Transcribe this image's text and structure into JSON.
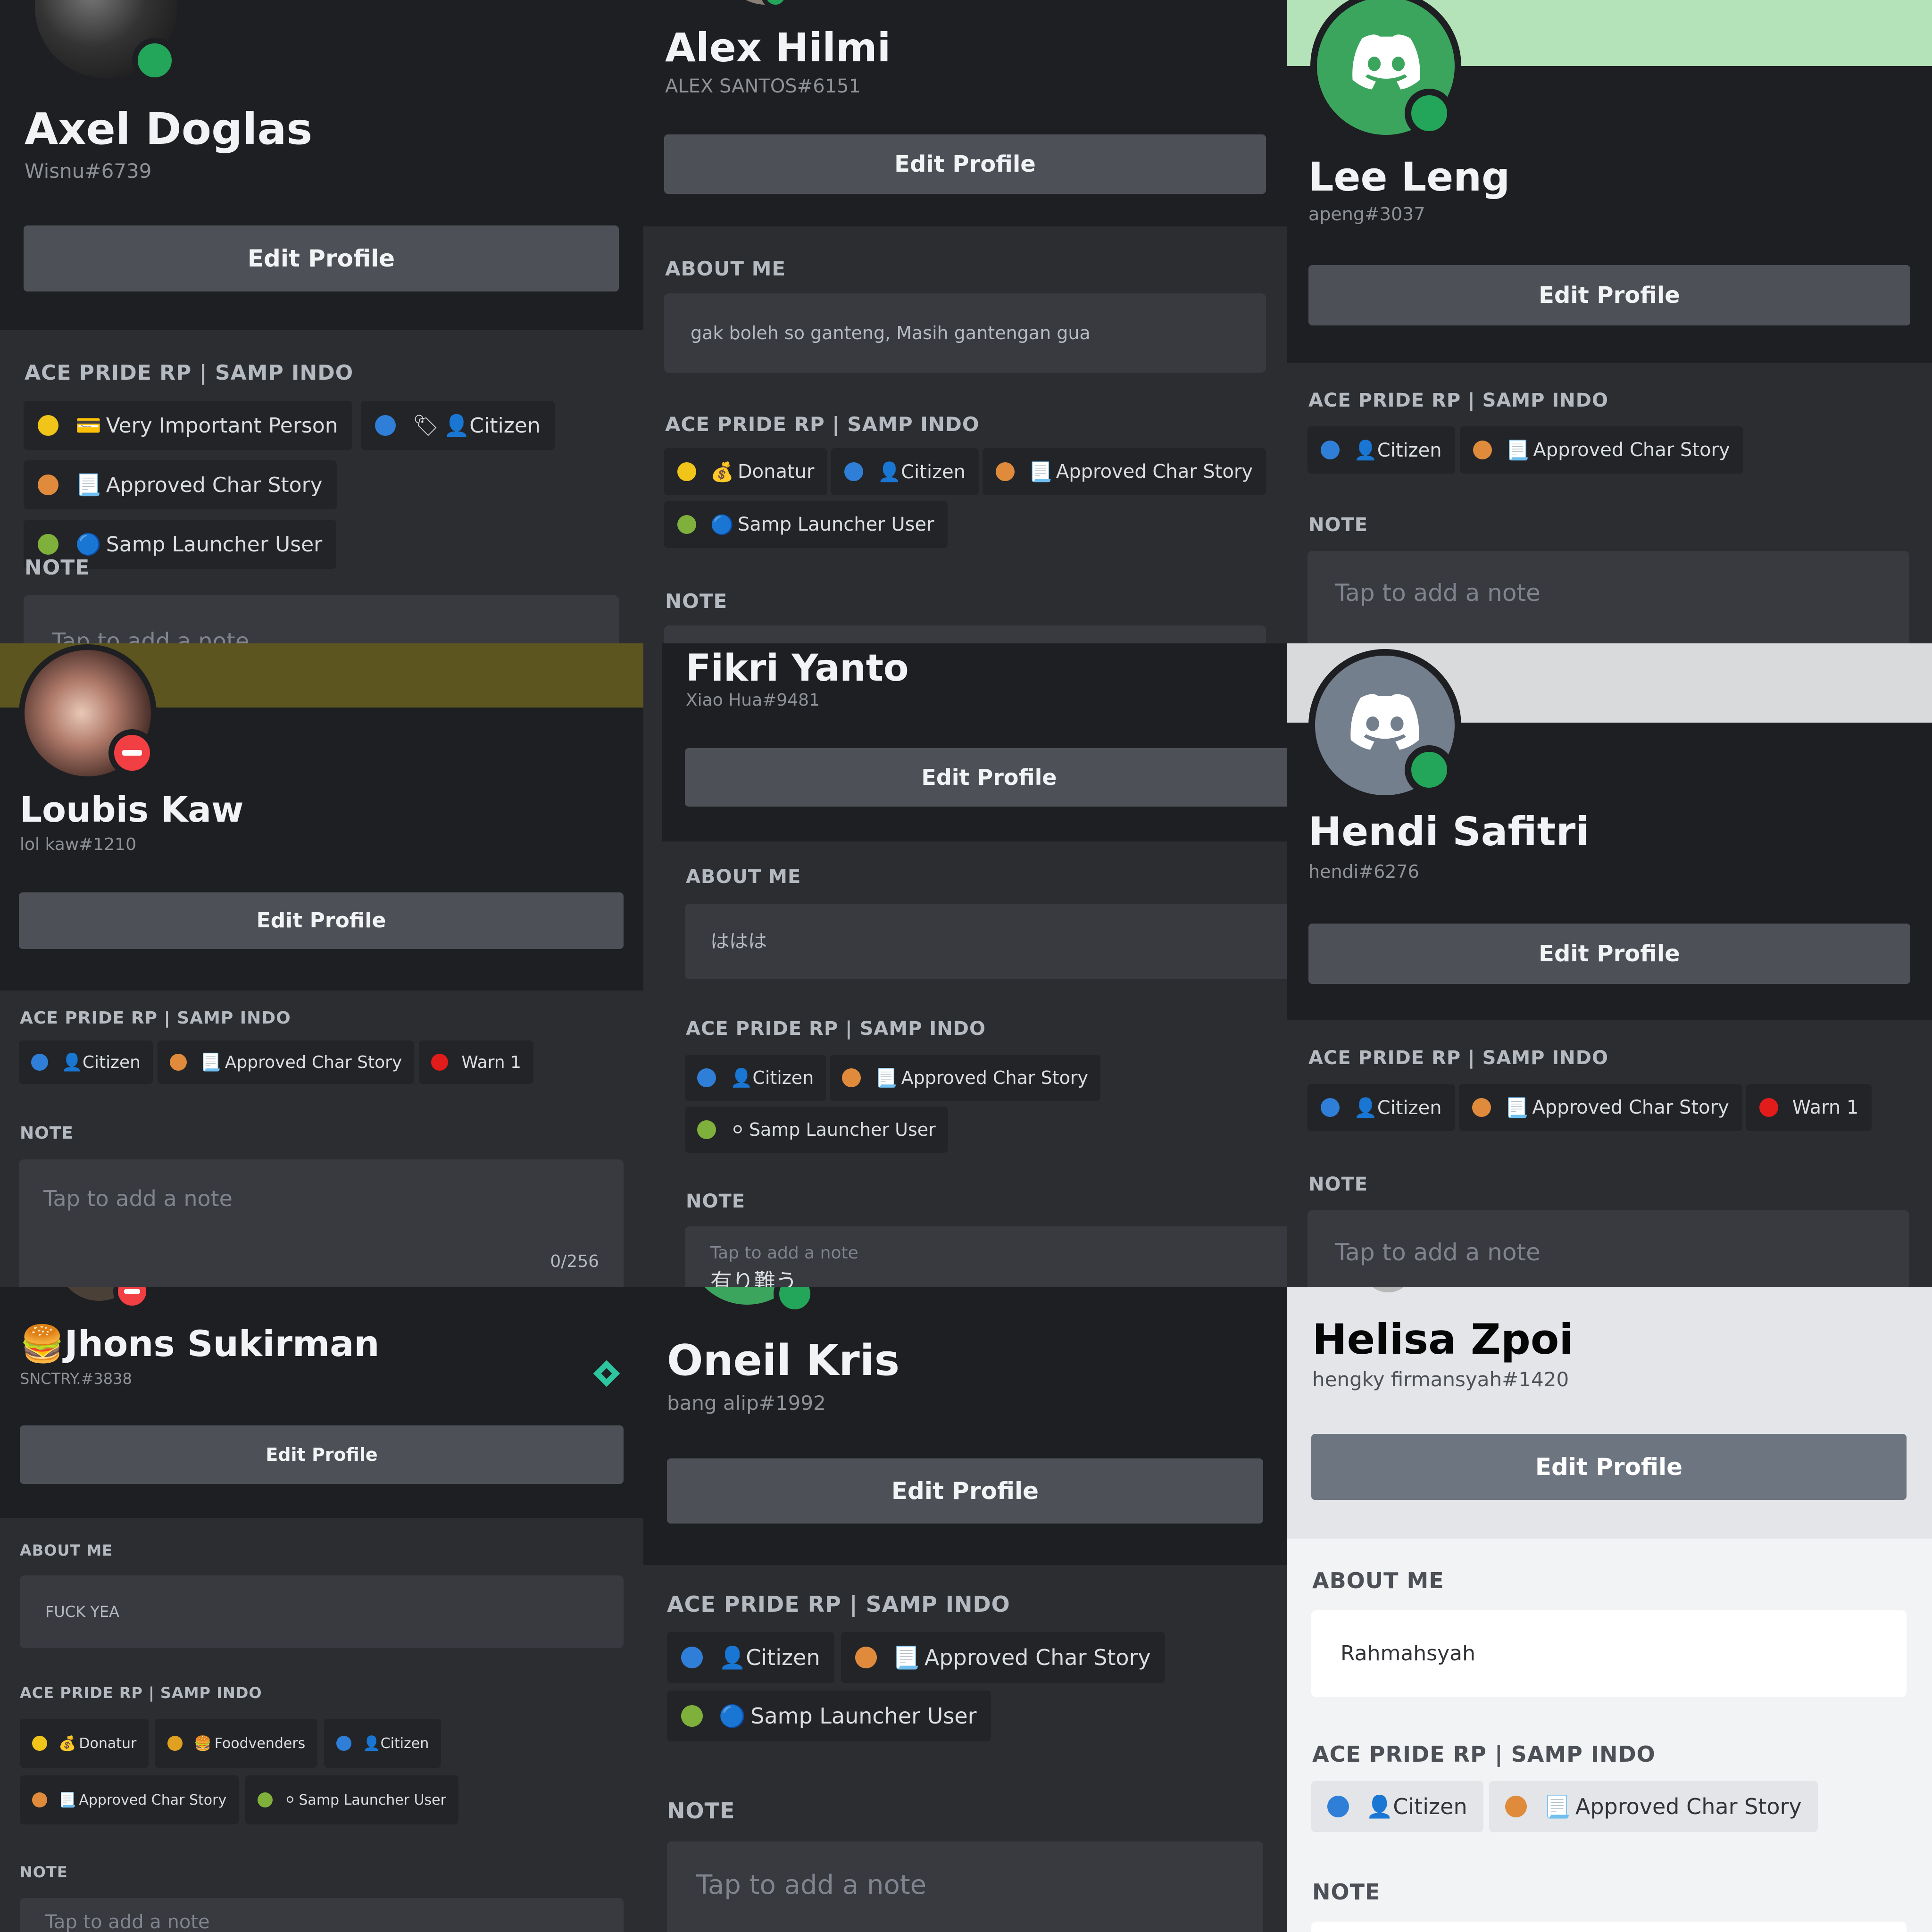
{
  "panels": [
    {
      "name": "Axel Doglas",
      "tag": "Wisnu#6739",
      "edit_label": "Edit Profile",
      "server_title": "ACE PRIDE RP | SAMP INDO",
      "note_title": "NOTE",
      "note_placeholder": "Tap to add a note",
      "roles": [
        {
          "dot": "#f0c419",
          "icon": "💳",
          "label": "Very Important Person"
        },
        {
          "dot": "#2f7fd8",
          "icon": "🏷",
          "label": "👤Citizen"
        },
        {
          "dot": "#e08b3c",
          "icon": "📃",
          "label": "Approved Char Story"
        },
        {
          "dot": "#7fb03c",
          "icon": "🔵",
          "label": "Samp Launcher User"
        }
      ]
    },
    {
      "name": "Alex Hilmi",
      "tag": "ALEX SANTOS#6151",
      "edit_label": "Edit Profile",
      "about_title": "ABOUT ME",
      "about_text": "gak boleh so ganteng, Masih gantengan gua",
      "server_title": "ACE PRIDE RP | SAMP INDO",
      "note_title": "NOTE",
      "roles": [
        {
          "dot": "#f0c419",
          "icon": "💰",
          "label": "Donatur"
        },
        {
          "dot": "#2f7fd8",
          "icon": "",
          "label": "👤Citizen"
        },
        {
          "dot": "#e08b3c",
          "icon": "📃",
          "label": "Approved Char Story"
        },
        {
          "dot": "#7fb03c",
          "icon": "🔵",
          "label": "Samp Launcher User"
        }
      ]
    },
    {
      "name": "Lee Leng",
      "tag": "apeng#3037",
      "edit_label": "Edit Profile",
      "server_title": "ACE PRIDE RP | SAMP INDO",
      "note_title": "NOTE",
      "note_placeholder": "Tap to add a note",
      "roles": [
        {
          "dot": "#2f7fd8",
          "icon": "",
          "label": "👤Citizen"
        },
        {
          "dot": "#e08b3c",
          "icon": "📃",
          "label": "Approved Char Story"
        }
      ]
    },
    {
      "name": "Loubis Kaw",
      "tag": "lol kaw#1210",
      "edit_label": "Edit Profile",
      "server_title": "ACE PRIDE RP | SAMP INDO",
      "note_title": "NOTE",
      "note_placeholder": "Tap to add a note",
      "note_counter": "0/256",
      "roles": [
        {
          "dot": "#2f7fd8",
          "icon": "",
          "label": "👤Citizen"
        },
        {
          "dot": "#e08b3c",
          "icon": "📃",
          "label": "Approved Char Story"
        },
        {
          "dot": "#e21b1b",
          "icon": "",
          "label": "Warn 1"
        }
      ]
    },
    {
      "name": "Fikri Yanto",
      "tag": "Xiao Hua#9481",
      "edit_label": "Edit Profile",
      "about_title": "ABOUT ME",
      "about_text": "ははは",
      "server_title": "ACE PRIDE RP | SAMP INDO",
      "note_title": "NOTE",
      "note_placeholder": "Tap to add a note",
      "note_text": "有り難う",
      "roles": [
        {
          "dot": "#2f7fd8",
          "icon": "",
          "label": "👤Citizen"
        },
        {
          "dot": "#e08b3c",
          "icon": "📃",
          "label": "Approved Char Story"
        },
        {
          "dot": "#7fb03c",
          "icon": "⚪",
          "label": "Samp Launcher User"
        }
      ]
    },
    {
      "name": "Hendi Safitri",
      "tag": "hendi#6276",
      "edit_label": "Edit Profile",
      "server_title": "ACE PRIDE RP | SAMP INDO",
      "note_title": "NOTE",
      "note_placeholder": "Tap to add a note",
      "roles": [
        {
          "dot": "#2f7fd8",
          "icon": "",
          "label": "👤Citizen"
        },
        {
          "dot": "#e08b3c",
          "icon": "📃",
          "label": "Approved Char Story"
        },
        {
          "dot": "#e21b1b",
          "icon": "",
          "label": "Warn 1"
        }
      ]
    },
    {
      "name": "🍔Jhons Sukirman",
      "tag": "SNCTRY.#3838",
      "edit_label": "Edit Profile",
      "about_title": "ABOUT ME",
      "about_text": "FUCK YEA",
      "server_title": "ACE PRIDE RP | SAMP INDO",
      "note_title": "NOTE",
      "note_placeholder": "Tap to add a note",
      "roles": [
        {
          "dot": "#f0c419",
          "icon": "💰",
          "label": "Donatur"
        },
        {
          "dot": "#e0a020",
          "icon": "🍔",
          "label": "Foodvenders"
        },
        {
          "dot": "#2f7fd8",
          "icon": "",
          "label": "👤Citizen"
        },
        {
          "dot": "#e08b3c",
          "icon": "📃",
          "label": "Approved Char Story"
        },
        {
          "dot": "#7fb03c",
          "icon": "⚪",
          "label": "Samp Launcher User"
        }
      ]
    },
    {
      "name": "Oneil Kris",
      "tag": "bang alip#1992",
      "edit_label": "Edit Profile",
      "server_title": "ACE PRIDE RP | SAMP INDO",
      "note_title": "NOTE",
      "note_placeholder": "Tap to add a note",
      "roles": [
        {
          "dot": "#2f7fd8",
          "icon": "",
          "label": "👤Citizen"
        },
        {
          "dot": "#e08b3c",
          "icon": "📃",
          "label": "Approved Char Story"
        },
        {
          "dot": "#7fb03c",
          "icon": "🔵",
          "label": "Samp Launcher User"
        }
      ]
    },
    {
      "name": "Helisa Zpoi",
      "tag": "hengky firmansyah#1420",
      "edit_label": "Edit Profile",
      "about_title": "ABOUT ME",
      "about_text": "Rahmahsyah",
      "server_title": "ACE PRIDE RP | SAMP INDO",
      "note_title": "NOTE",
      "roles": [
        {
          "dot": "#2f7fd8",
          "icon": "",
          "label": "👤Citizen"
        },
        {
          "dot": "#e08b3c",
          "icon": "📃",
          "label": "Approved Char Story"
        }
      ]
    }
  ],
  "colors": {
    "online": "#23a55a",
    "dnd": "#f23f43",
    "blurple_green_avatar": "#3ba55d",
    "grey_avatar": "#747f8d",
    "banner_green": "#b5e3b9",
    "banner_olive": "#5c5520",
    "banner_grey": "#d9dadc"
  },
  "icons": [
    "discord-logo-icon",
    "online-status-icon",
    "dnd-status-icon",
    "nitro-diamond-icon"
  ]
}
